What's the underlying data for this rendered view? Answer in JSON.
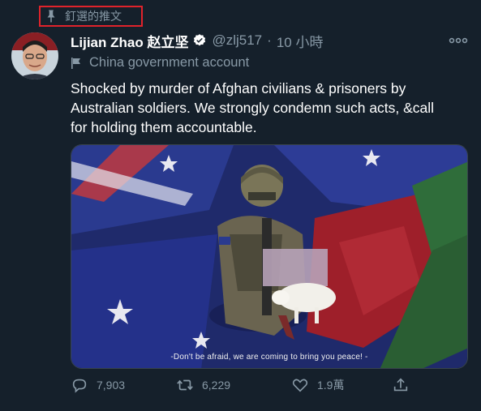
{
  "pinned": {
    "label": "釘選的推文"
  },
  "author": {
    "name": "Lijian Zhao 赵立坚",
    "handle": "@zlj517",
    "separator": "·",
    "time": "10 小時",
    "label": "China government account"
  },
  "tweet": {
    "text": "Shocked by murder of Afghan civilians & prisoners by Australian soldiers. We strongly condemn such acts, &call for holding them accountable.",
    "media_caption": "-Don't be afraid, we are coming to bring you peace! -"
  },
  "actions": {
    "reply_count": "7,903",
    "retweet_count": "6,229",
    "like_count": "1.9萬"
  },
  "colors": {
    "background": "#15202b",
    "secondary_text": "#8899a6",
    "highlight_box": "#e0232b",
    "verified": "#1da1f2"
  }
}
